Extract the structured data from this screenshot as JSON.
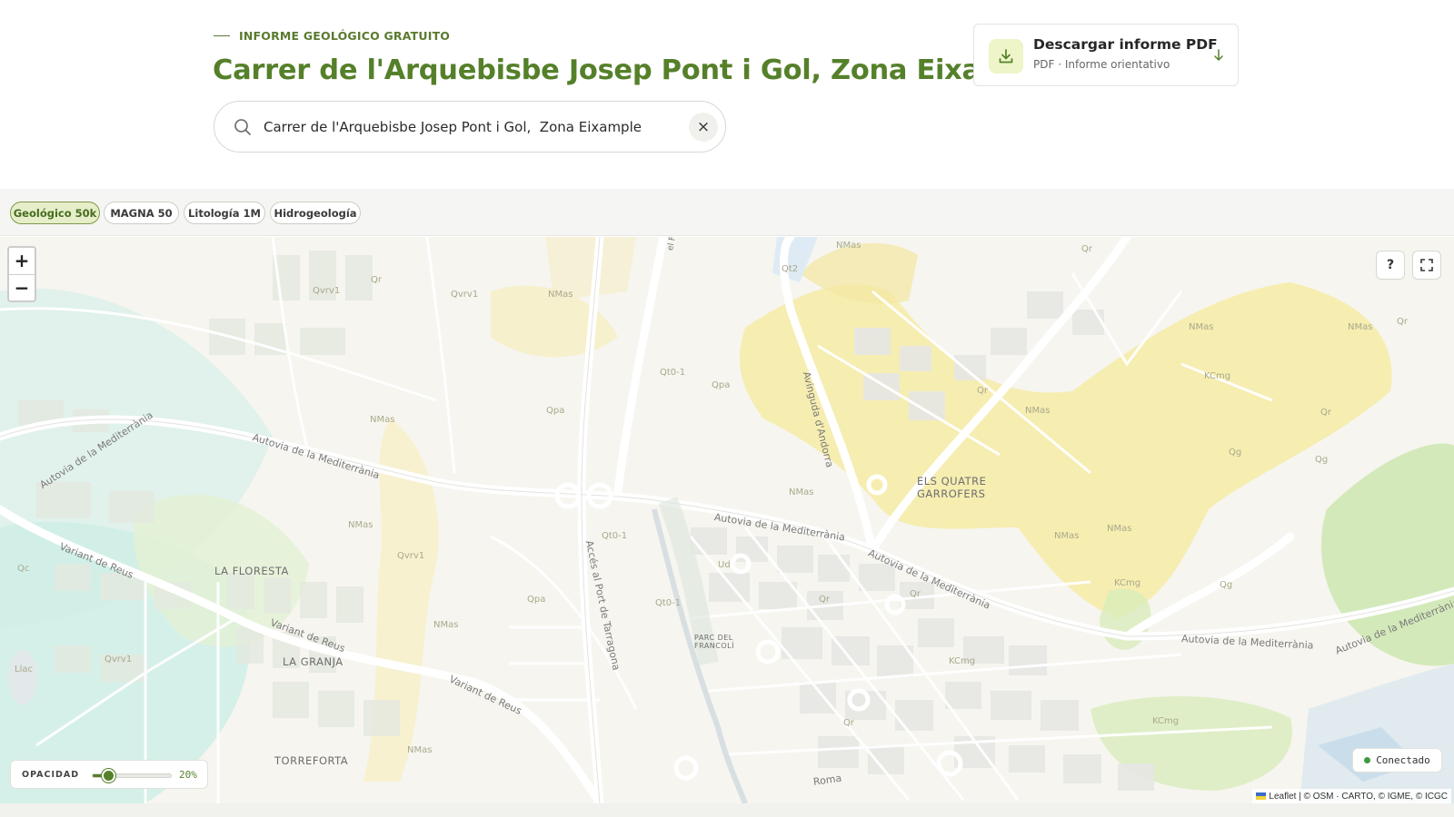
{
  "header": {
    "eyebrow": "INFORME GEOLÓGICO GRATUITO",
    "title": "Carrer de l'Arquebisbe Josep Pont i Gol, Zona Eixample"
  },
  "search": {
    "value": "Carrer de l'Arquebisbe Josep Pont i Gol,  Zona Eixample",
    "clear_label": "×"
  },
  "pdf": {
    "title": "Descargar informe PDF",
    "subtitle": "PDF · Informe orientativo"
  },
  "layers": [
    {
      "label": "Geológico 50k",
      "active": true
    },
    {
      "label": "MAGNA 50",
      "active": false
    },
    {
      "label": "Litología 1M",
      "active": false
    },
    {
      "label": "Hidrogeología",
      "active": false
    }
  ],
  "map": {
    "zoom_in": "+",
    "zoom_out": "−",
    "help": "?",
    "places": {
      "la_floresta": "LA FLORESTA",
      "la_granja": "LA GRANJA",
      "torreforta": "TORREFORTA",
      "quatre_1": "ELS QUATRE",
      "quatre_2": "GARROFERS",
      "parc_1": "PARC DEL",
      "parc_2": "FRANCOLÍ"
    },
    "roads": {
      "autovia_1": "Autovia de la Mediterrània",
      "autovia_2": "Autovia de la Mediterrània",
      "autovia_3": "Autovia de la Mediterrània",
      "autovia_4": "Autovia de la Mediterrània",
      "autovia_5": "Autovia de la Mediterrània",
      "autovia_6": "Autovia de la Mediterrània",
      "variant_1": "Variant de Reus",
      "variant_2": "Variant de Reus",
      "variant_3": "Variant de Reus",
      "acces": "Accés al Port de Tarragona",
      "andorra": "Avinguda d'Andorra",
      "francoli": "el Francolí",
      "roma": "Roma"
    },
    "geo_units": [
      "NMas",
      "Qr",
      "Qvrv1",
      "Qpa",
      "Qt0-1",
      "KCmg",
      "Qc",
      "Qt2",
      "Ud",
      "Llac",
      "Qg"
    ],
    "opacity_label": "OPACIDAD",
    "opacity_value": "20%",
    "opacity_fraction": 0.2,
    "status": "Conectado",
    "attribution": "Leaflet | © OSM · CARTO, © IGME, © ICGC"
  },
  "colors": {
    "brand": "#55802a",
    "active_chip": "#e5eec9",
    "geo_yellow": "#f6eba6",
    "geo_green": "#cfe8b4",
    "geo_teal": "#d7efe9"
  }
}
